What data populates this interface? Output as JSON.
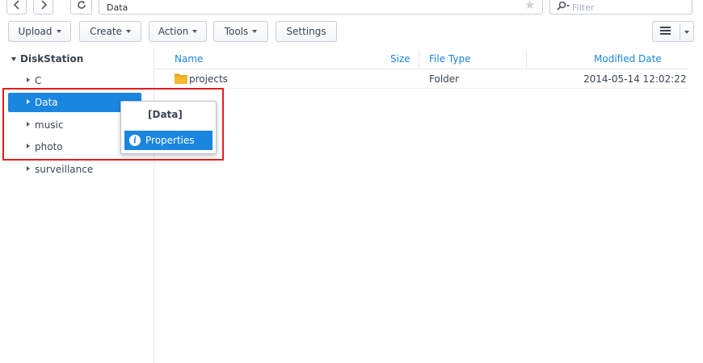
{
  "nav": {
    "back_icon": "chevron-left-icon",
    "forward_icon": "chevron-right-icon",
    "refresh_icon": "refresh-icon",
    "path": "Data",
    "favorite_icon": "star-icon",
    "filter_placeholder": "Filter",
    "search_icon": "search-icon"
  },
  "toolbar": {
    "upload": "Upload",
    "create": "Create",
    "action": "Action",
    "tools": "Tools",
    "settings": "Settings",
    "view_icon": "list-view-icon"
  },
  "tree": {
    "root": "DiskStation",
    "items": [
      {
        "label": "C",
        "selected": false
      },
      {
        "label": "Data",
        "selected": true
      },
      {
        "label": "music",
        "selected": false
      },
      {
        "label": "photo",
        "selected": false
      },
      {
        "label": "surveillance",
        "selected": false
      }
    ]
  },
  "filelist": {
    "columns": {
      "name": "Name",
      "size": "Size",
      "type": "File Type",
      "modified": "Modified Date"
    },
    "rows": [
      {
        "name": "projects",
        "size": "",
        "type": "Folder",
        "modified": "2014-05-14 12:02:22",
        "icon": "folder-icon"
      }
    ]
  },
  "context_menu": {
    "title": "[Data]",
    "items": [
      {
        "label": "Properties",
        "icon": "info-icon"
      }
    ]
  },
  "colors": {
    "accent": "#1a86e0",
    "highlight_border": "#e31d1d",
    "folder": "#f5b82e"
  }
}
